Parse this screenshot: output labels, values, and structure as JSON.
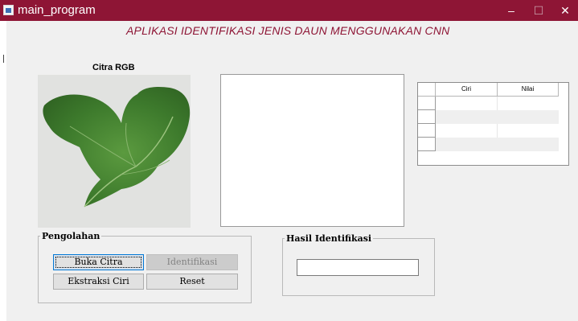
{
  "window": {
    "title": "main_program",
    "minimize_glyph": "–",
    "maximize_glyph": "☐",
    "close_glyph": "✕"
  },
  "app": {
    "heading": "APLIKASI IDENTIFIKASI JENIS DAUN MENGGUNAKAN CNN"
  },
  "image_panel": {
    "label": "Citra RGB",
    "image_subject": "green leaf"
  },
  "table": {
    "columns": [
      "Ciri",
      "Nilai"
    ],
    "rows": [
      [
        "",
        ""
      ],
      [
        "",
        ""
      ],
      [
        "",
        ""
      ],
      [
        "",
        ""
      ]
    ]
  },
  "pengolahan": {
    "title": "Pengolahan",
    "buttons": {
      "buka_citra": "Buka Citra",
      "identifikasi": "Identifikasi",
      "ekstraksi_ciri": "Ekstraksi Ciri",
      "reset": "Reset"
    }
  },
  "hasil": {
    "title": "Hasil Identifikasi",
    "value": ""
  },
  "colors": {
    "titlebar": "#8e1535",
    "heading": "#8e1535",
    "window_bg": "#f0f0f0",
    "leaf": "#3f7d2f"
  }
}
